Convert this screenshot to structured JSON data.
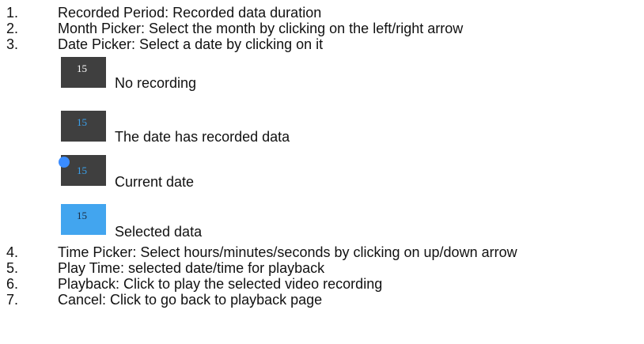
{
  "items_top": [
    {
      "number": "1.",
      "text": "Recorded Period: Recorded data duration"
    },
    {
      "number": "2.",
      "text": "Month Picker: Select the month by clicking on the left/right arrow"
    },
    {
      "number": "3.",
      "text": "Date Picker: Select a date by clicking on it"
    }
  ],
  "legend": [
    {
      "tile_text": "15",
      "label": "No recording"
    },
    {
      "tile_text": "15",
      "label": "The date has recorded data"
    },
    {
      "tile_text": "15",
      "label": "Current date"
    },
    {
      "tile_text": "15",
      "label": "Selected data"
    }
  ],
  "items_bottom": [
    {
      "number": "4.",
      "text": "Time Picker: Select hours/minutes/seconds by clicking on up/down arrow"
    },
    {
      "number": "5.",
      "text": "Play Time: selected date/time for playback"
    },
    {
      "number": "6.",
      "text": "Playback: Click to play the selected video recording"
    },
    {
      "number": "7.",
      "text": "Cancel: Click to go back to playback page"
    }
  ],
  "colors": {
    "tile_dark": "#3f3f3f",
    "tile_selected": "#42a5ef",
    "recorded_number": "#3aa3f0",
    "current_dot": "#3a8cff"
  }
}
